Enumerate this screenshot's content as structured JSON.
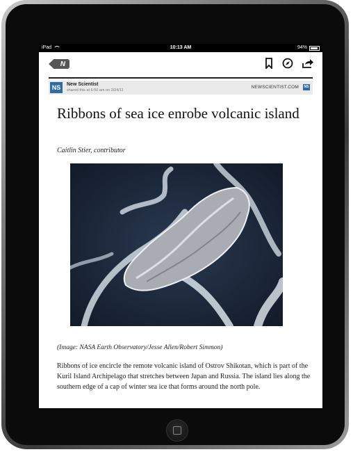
{
  "status_bar": {
    "device": "iPad",
    "time": "10:13 AM",
    "battery": "94%"
  },
  "toolbar": {
    "back_label": "N",
    "icons": [
      "bookmark-icon",
      "compass-icon",
      "share-icon"
    ]
  },
  "source": {
    "logo": "NS",
    "name": "New Scientist",
    "meta": "shared this at 6:50 am on 2/24/11",
    "url": "NEWSCIENTIST.COM",
    "logo_small": "NS"
  },
  "article": {
    "headline": "Ribbons of sea ice enrobe volcanic island",
    "byline": "Caitlin Stier, contributor",
    "caption": "(Image: NASA Earth Observatory/Jesse Allen/Robert Simmon)",
    "body": "Ribbons of ice encircle the remote volcanic island of Ostrov Shikotan, which is part of the Kuril Island Archipelago that stretches between Japan and Russia. The island lies along the southern edge of a cap of winter sea ice that forms around the north pole."
  }
}
